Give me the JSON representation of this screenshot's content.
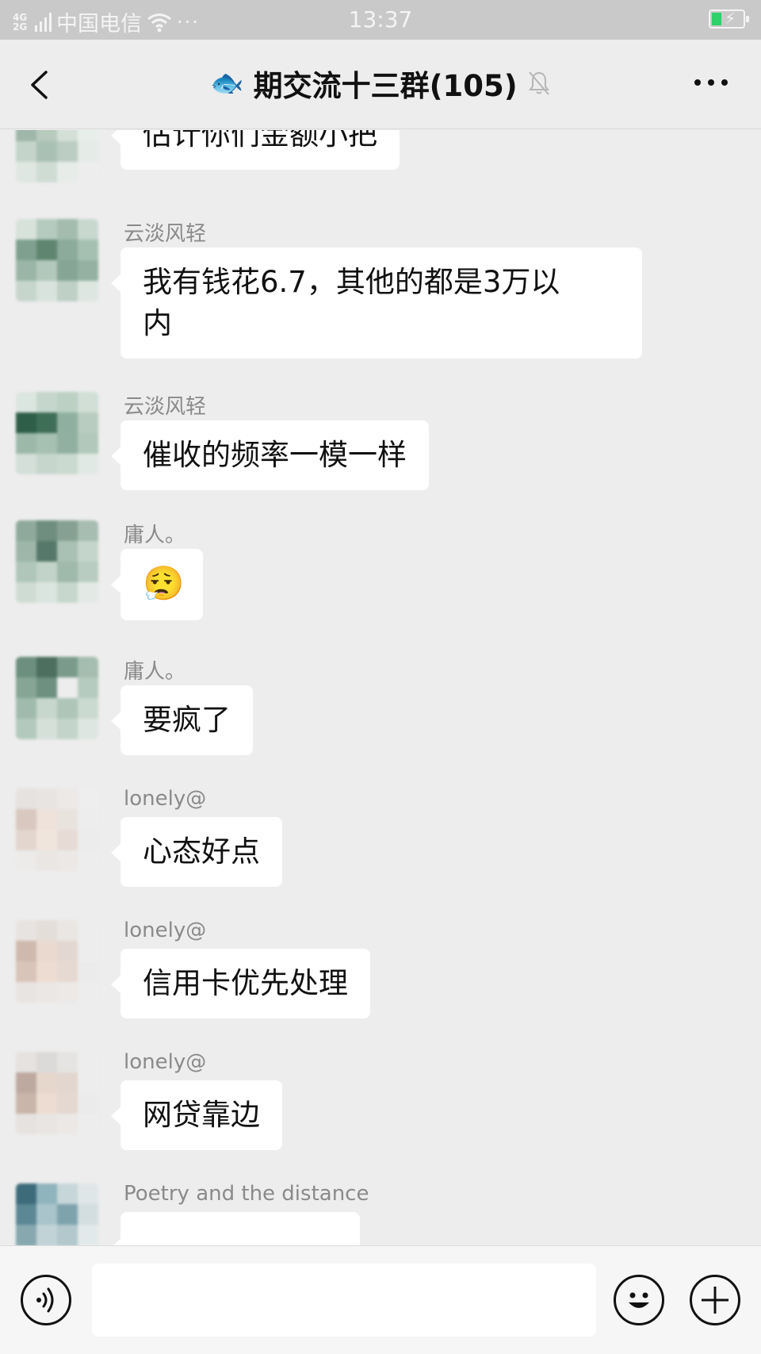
{
  "status_bar": {
    "network_type": "4G 2G",
    "carrier": "中国电信",
    "time": "13:37",
    "battery_level": 0.3,
    "charging": true
  },
  "nav": {
    "back_icon": "chevron-left-icon",
    "title_emoji": "🐟",
    "title": "期交流十三群(105)",
    "mute_icon": "bell-muted-icon",
    "more_icon": "more-dots-icon"
  },
  "messages": [
    {
      "sender": "",
      "text": "估计你们金额小把"
    },
    {
      "sender": "云淡风轻",
      "text": "我有钱花6.7，其他的都是3万以\n内"
    },
    {
      "sender": "云淡风轻",
      "text": "催收的频率一模一样"
    },
    {
      "sender": "庸人。",
      "text": "😮‍💨"
    },
    {
      "sender": "庸人。",
      "text": "要疯了"
    },
    {
      "sender": "lonely@",
      "text": "心态好点"
    },
    {
      "sender": "lonely@",
      "text": "信用卡优先处理"
    },
    {
      "sender": "lonely@",
      "text": "网贷靠边"
    },
    {
      "sender": "Poetry and the distance",
      "text": ""
    }
  ],
  "input_bar": {
    "voice_icon": "voice-icon",
    "input_value": "",
    "emoji_icon": "smiley-icon",
    "plus_icon": "plus-icon"
  },
  "colors": {
    "background": "#ededed",
    "bubble": "#ffffff",
    "status_bar": "#c9c9c9",
    "battery": "#2ed16a"
  }
}
